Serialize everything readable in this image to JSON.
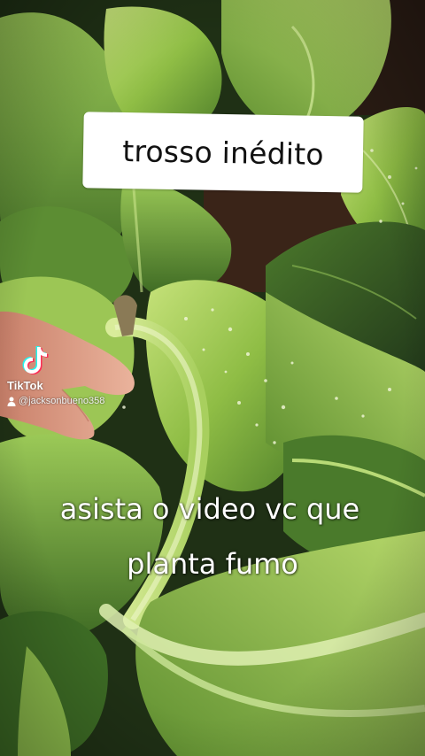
{
  "overlay": {
    "title": "trosso inédito",
    "caption_line_1": "asista o video vc que",
    "caption_line_2": "planta fumo"
  },
  "watermark": {
    "brand": "TikTok",
    "handle": "@jacksonbueno358",
    "logo_icon": "tiktok-note-icon",
    "user_icon": "user-icon"
  },
  "scene": {
    "subject": "tobacco plant leaves with spots, hand touching stem",
    "colors": {
      "leaf_light": "#a9cf5a",
      "leaf_mid": "#7fae3c",
      "leaf_dark": "#3e6a22",
      "soil": "#3a2418",
      "skin": "#e2a58a"
    }
  }
}
